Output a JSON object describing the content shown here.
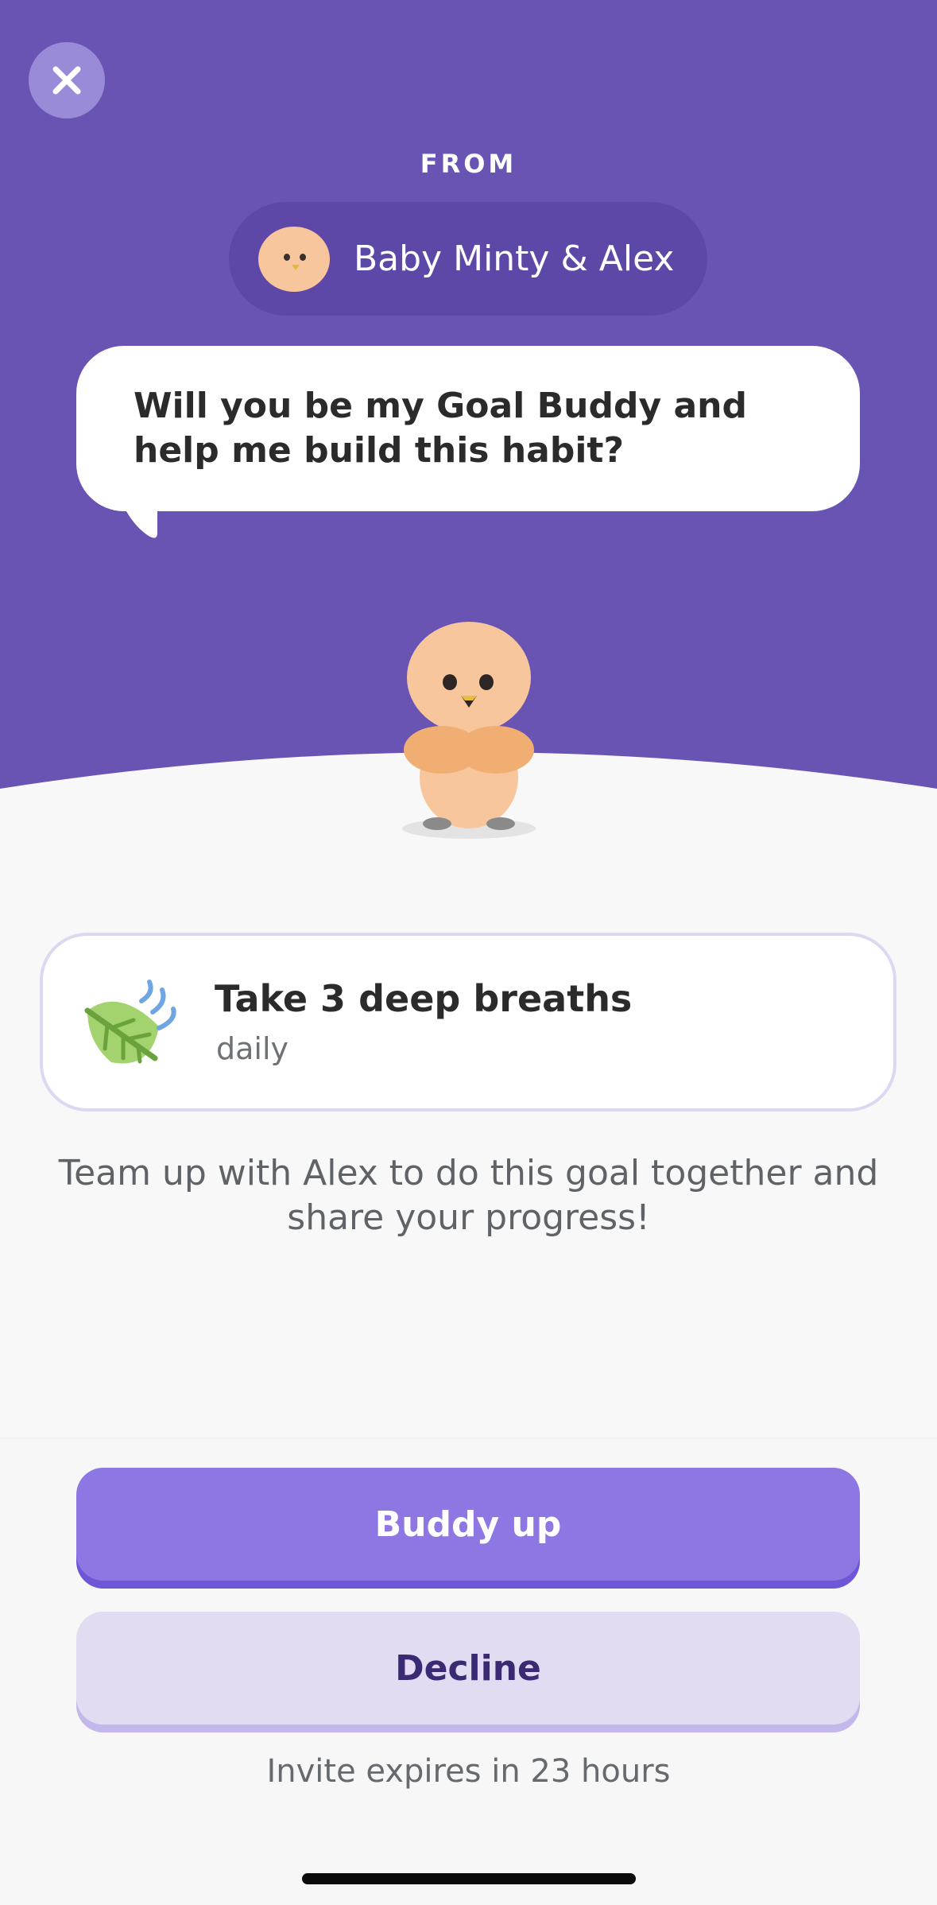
{
  "header": {
    "close_icon": "close-icon",
    "from_label": "FROM",
    "sender_name": "Baby Minty & Alex",
    "message": "Will you be my Goal Buddy and help me build this habit?"
  },
  "goal": {
    "icon": "leaf-wind-icon",
    "title": "Take 3 deep breaths",
    "frequency": "daily"
  },
  "description": "Team up with Alex to do this goal together and share your progress!",
  "actions": {
    "primary_label": "Buddy up",
    "secondary_label": "Decline"
  },
  "footer": {
    "expires_text": "Invite expires in 23 hours"
  },
  "colors": {
    "header_purple": "#6954b4",
    "button_primary": "#8f77e3",
    "button_secondary": "#e2dcf2"
  }
}
